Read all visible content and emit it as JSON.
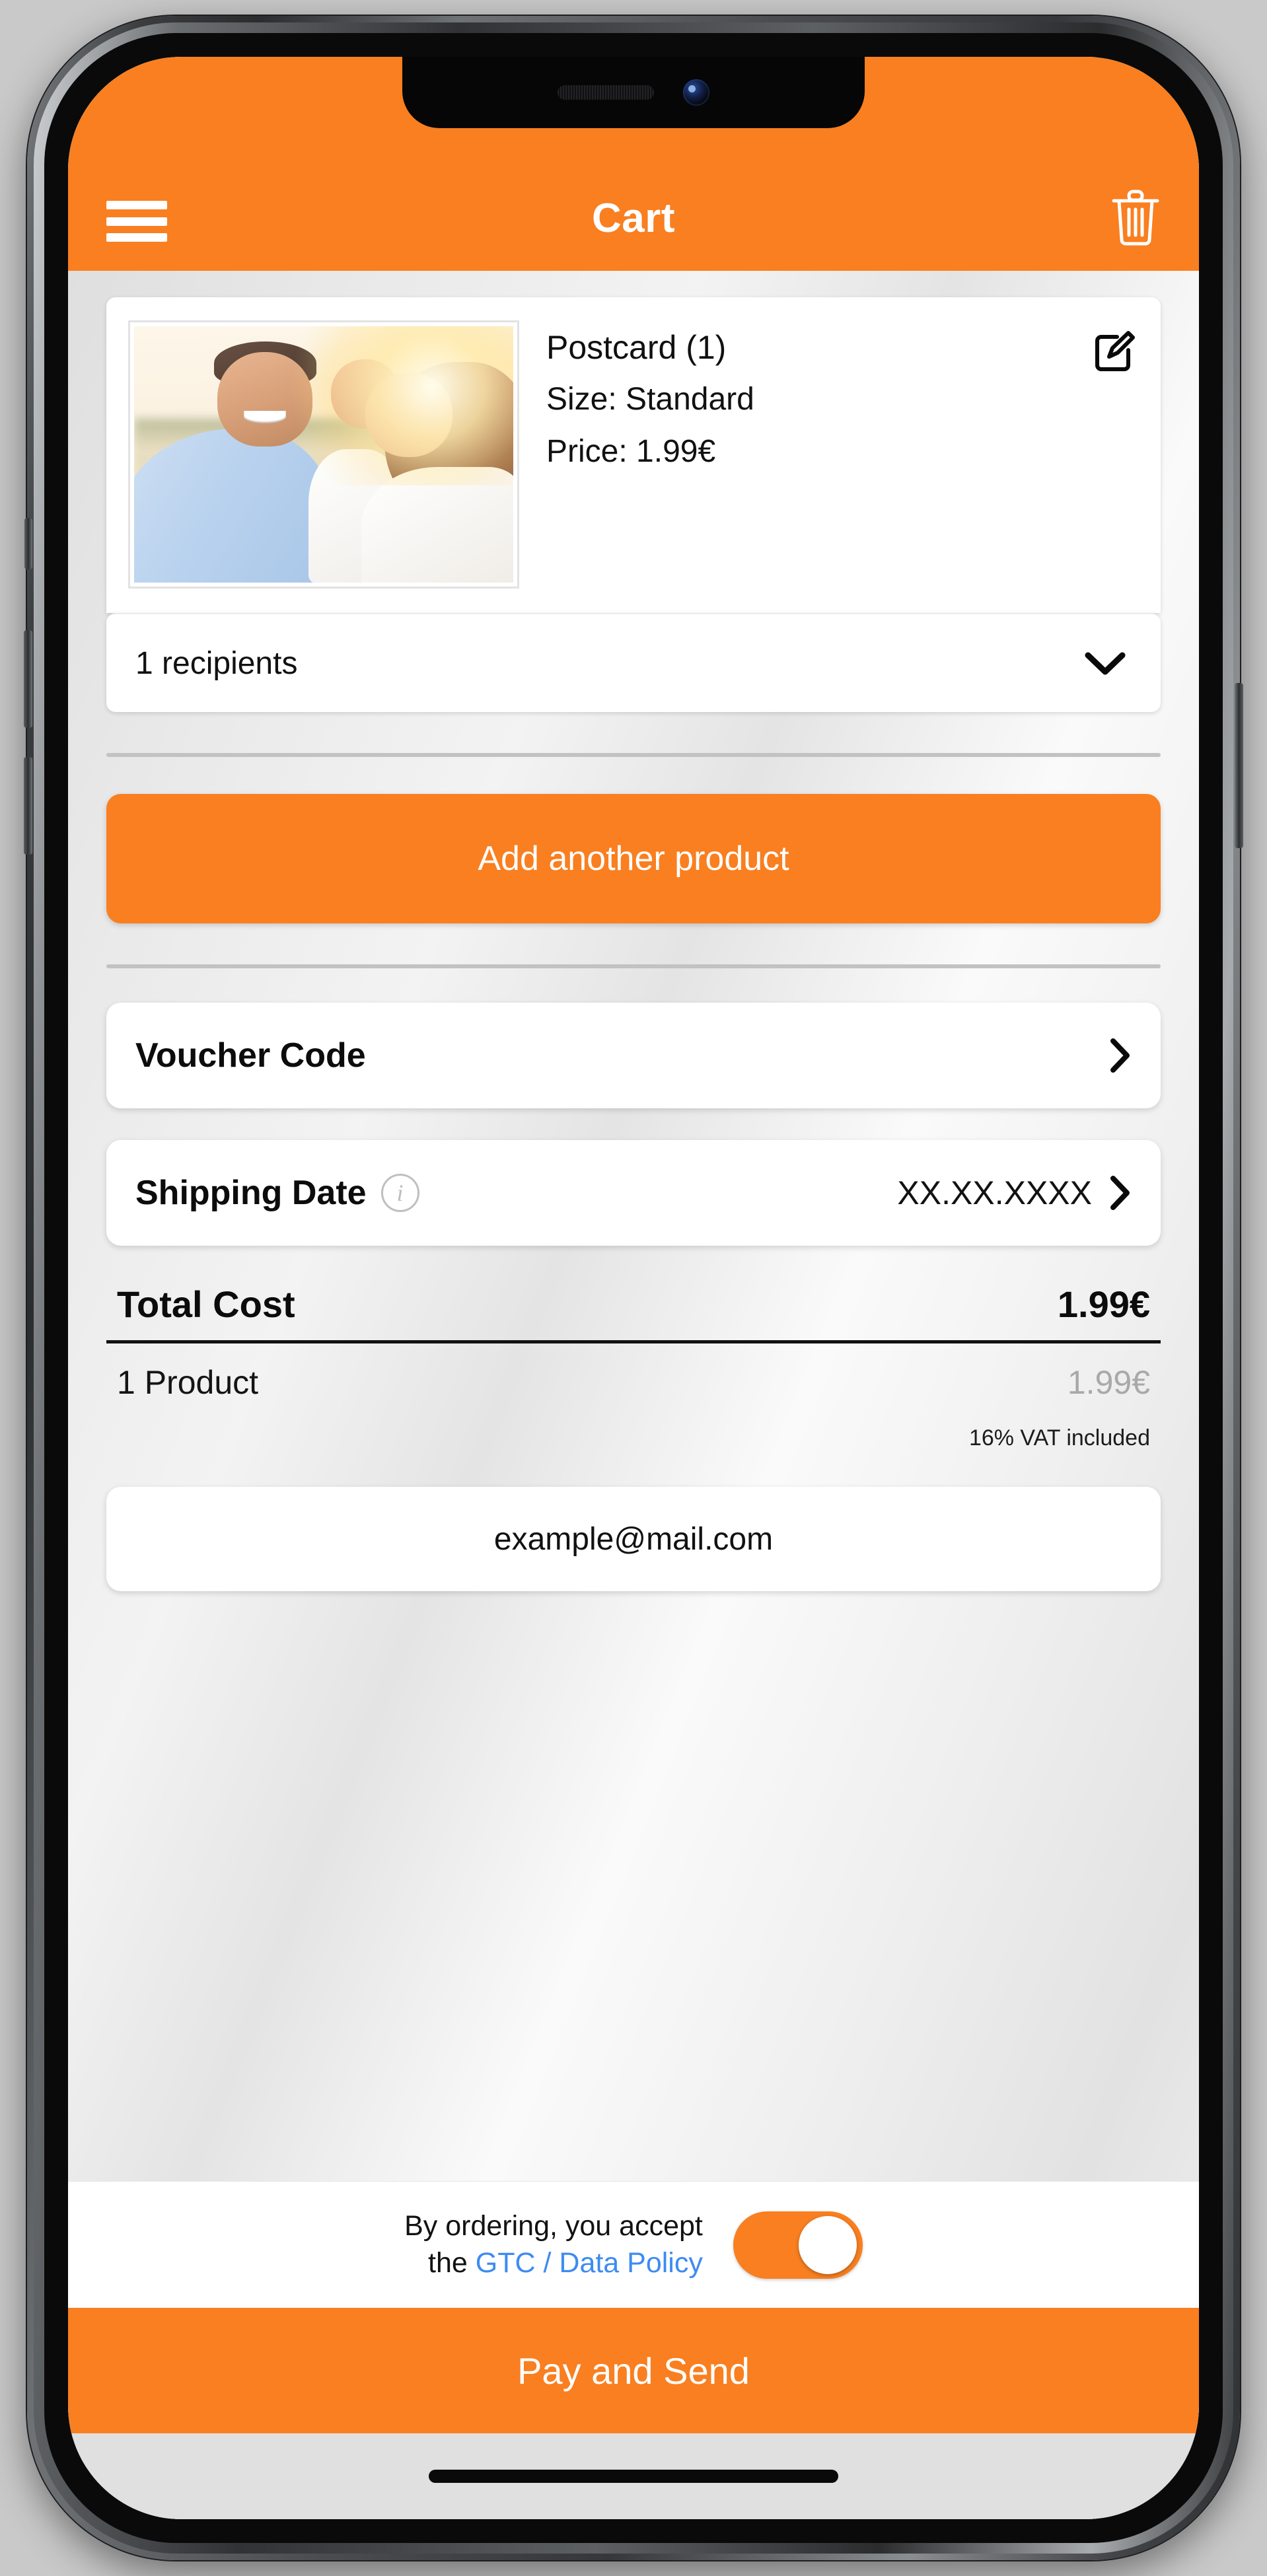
{
  "app": {
    "header": {
      "title": "Cart",
      "menu_icon": "hamburger-menu-icon",
      "delete_icon": "trash-icon"
    },
    "product": {
      "title": "Postcard (1)",
      "size_line": "Size: Standard",
      "price_line": "Price: 1.99€",
      "edit_icon": "edit-pencil-icon",
      "thumbnail_alt": "family-selfie-photo"
    },
    "recipients": {
      "label": "1 recipients",
      "expand_icon": "chevron-down-icon"
    },
    "add_product_button": "Add another product",
    "voucher": {
      "label": "Voucher Code",
      "chevron_icon": "chevron-right-icon"
    },
    "shipping": {
      "label": "Shipping Date",
      "info_icon": "info-icon",
      "info_glyph": "i",
      "value": "XX.XX.XXXX",
      "chevron_icon": "chevron-right-icon"
    },
    "totals": {
      "total_label": "Total Cost",
      "total_value": "1.99€",
      "subtotal_label": "1 Product",
      "subtotal_value": "1.99€",
      "vat_note": "16% VAT included"
    },
    "email": {
      "value": "example@mail.com",
      "placeholder": "example@mail.com"
    },
    "footer": {
      "accept_line1": "By ordering, you accept",
      "accept_line2_prefix": "the ",
      "accept_link": "GTC / Data Policy",
      "toggle_state": "on",
      "pay_button": "Pay and Send"
    },
    "colors": {
      "brand_orange": "#f97f20",
      "link_blue": "#3d8bf2",
      "muted_grey": "#a9a9a9",
      "divider_grey": "#c2c2c2"
    }
  }
}
